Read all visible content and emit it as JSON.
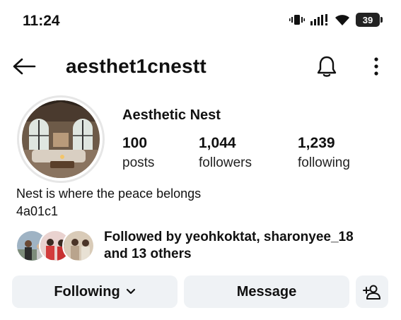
{
  "status_bar": {
    "time": "11:24",
    "battery": "39",
    "icons": [
      "vibrate-icon",
      "signal-icon",
      "wifi-icon",
      "battery-icon"
    ]
  },
  "header": {
    "username": "aesthet1cnestt",
    "icons": [
      "back-arrow-icon",
      "bell-icon",
      "more-vertical-icon"
    ]
  },
  "profile": {
    "display_name": "Aesthetic Nest",
    "stats": {
      "posts": {
        "value": "100",
        "label": "posts"
      },
      "followers": {
        "value": "1,044",
        "label": "followers"
      },
      "following": {
        "value": "1,239",
        "label": "following"
      }
    },
    "bio_line1": "Nest is where the peace belongs",
    "bio_line2": "4a01c1"
  },
  "followed_by": {
    "line1": "Followed by yeohkoktat, sharonyee_18",
    "line2": "and 13 others"
  },
  "actions": {
    "following_label": "Following",
    "message_label": "Message",
    "add_user_icon": "person-add-icon"
  },
  "colors": {
    "button_bg": "#eff2f5",
    "text": "#111111",
    "avatar_ring": "#e6e6e6"
  }
}
